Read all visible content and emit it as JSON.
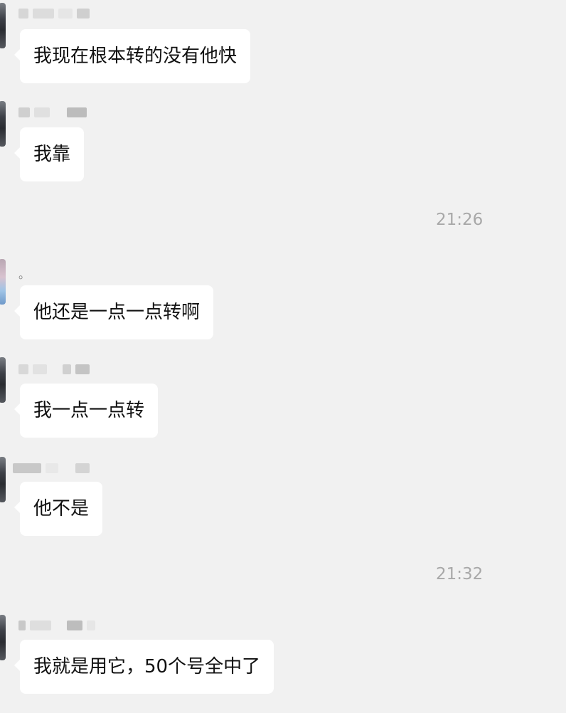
{
  "chat": {
    "messages": [
      {
        "text": "我现在根本转的没有他快"
      },
      {
        "text": "我靠"
      },
      {
        "text": "他还是一点一点转啊",
        "sender_note": "。"
      },
      {
        "text": "我一点一点转"
      },
      {
        "text": "他不是"
      },
      {
        "text": "我就是用它，50个号全中了"
      }
    ],
    "timestamps": [
      "21:26",
      "21:32"
    ]
  },
  "colors": {
    "background": "#f1f1f1",
    "bubble": "#ffffff",
    "text": "#111111",
    "timestamp": "#a8a8a8"
  }
}
